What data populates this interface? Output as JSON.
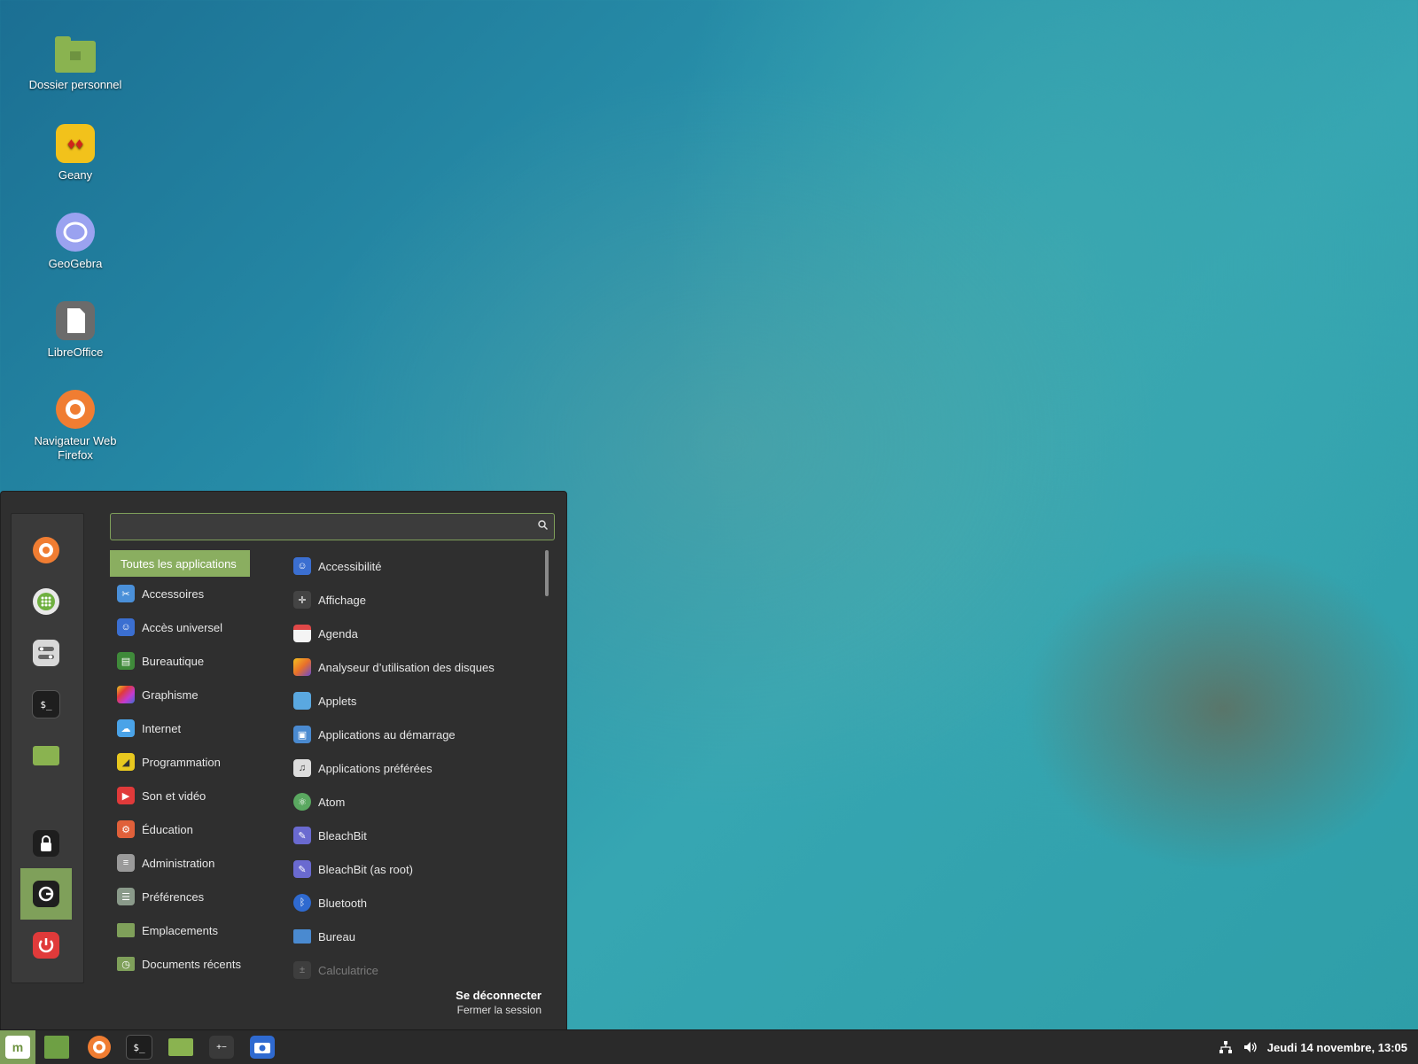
{
  "desktop": {
    "icons": [
      {
        "label": "Dossier personnel",
        "icon": "home-folder-icon"
      },
      {
        "label": "Geany",
        "icon": "geany-icon"
      },
      {
        "label": "GeoGebra",
        "icon": "geogebra-icon"
      },
      {
        "label": "LibreOffice",
        "icon": "libreoffice-icon"
      },
      {
        "label": "Navigateur Web Firefox",
        "icon": "firefox-icon"
      }
    ]
  },
  "menu": {
    "search": {
      "value": "",
      "placeholder": ""
    },
    "favorites": [
      {
        "icon": "firefox-icon"
      },
      {
        "icon": "software-manager-icon"
      },
      {
        "icon": "settings-icon"
      },
      {
        "icon": "terminal-icon"
      },
      {
        "icon": "folder-icon"
      },
      {
        "icon": "lock-icon"
      },
      {
        "icon": "logout-icon"
      },
      {
        "icon": "power-icon"
      }
    ],
    "categories": [
      {
        "label": "Toutes les applications",
        "icon": ""
      },
      {
        "label": "Accessoires",
        "icon": "accessories-icon",
        "color": "#4a90d9"
      },
      {
        "label": "Accès universel",
        "icon": "accessibility-icon",
        "color": "#3b6fd1"
      },
      {
        "label": "Bureautique",
        "icon": "office-icon",
        "color": "#3f8a3a"
      },
      {
        "label": "Graphisme",
        "icon": "graphics-icon",
        "color": "#c23ad1"
      },
      {
        "label": "Internet",
        "icon": "internet-icon",
        "color": "#4aa3e8"
      },
      {
        "label": "Programmation",
        "icon": "programming-icon",
        "color": "#e8c81f"
      },
      {
        "label": "Son et vidéo",
        "icon": "multimedia-icon",
        "color": "#e03a3a"
      },
      {
        "label": "Éducation",
        "icon": "education-icon",
        "color": "#e0603a"
      },
      {
        "label": "Administration",
        "icon": "administration-icon",
        "color": "#9a9a9a"
      },
      {
        "label": "Préférences",
        "icon": "preferences-icon",
        "color": "#8a9a8a"
      },
      {
        "label": "Emplacements",
        "icon": "places-icon",
        "color": "#7fa05a"
      },
      {
        "label": "Documents récents",
        "icon": "recent-documents-icon",
        "color": "#7fa05a"
      }
    ],
    "apps": [
      {
        "label": "Accessibilité",
        "icon": "accessibility-icon",
        "color": "#3b6fd1"
      },
      {
        "label": "Affichage",
        "icon": "display-icon",
        "color": "#444444"
      },
      {
        "label": "Agenda",
        "icon": "calendar-icon",
        "color": "#e04848"
      },
      {
        "label": "Analyseur d’utilisation des disques",
        "icon": "disk-usage-icon",
        "color": "#e8902a"
      },
      {
        "label": "Applets",
        "icon": "applets-icon",
        "color": "#5aa8e0"
      },
      {
        "label": "Applications au démarrage",
        "icon": "startup-apps-icon",
        "color": "#4a8ad0"
      },
      {
        "label": "Applications préférées",
        "icon": "preferred-apps-icon",
        "color": "#dddddd"
      },
      {
        "label": "Atom",
        "icon": "atom-icon",
        "color": "#5aa860"
      },
      {
        "label": "BleachBit",
        "icon": "bleachbit-icon",
        "color": "#6a6ad0"
      },
      {
        "label": "BleachBit (as root)",
        "icon": "bleachbit-root-icon",
        "color": "#6a6ad0"
      },
      {
        "label": "Bluetooth",
        "icon": "bluetooth-icon",
        "color": "#2f6ad0"
      },
      {
        "label": "Bureau",
        "icon": "desktop-icon",
        "color": "#4a8ad0"
      },
      {
        "label": "Calculatrice",
        "icon": "calculator-icon",
        "color": "#555555",
        "dim": true
      }
    ],
    "session": {
      "action": "Se déconnecter",
      "description": "Fermer la session"
    }
  },
  "taskbar": {
    "items": [
      {
        "icon": "show-desktop-icon"
      },
      {
        "icon": "firefox-icon"
      },
      {
        "icon": "terminal-icon"
      },
      {
        "icon": "file-manager-icon"
      },
      {
        "icon": "calculator-icon"
      },
      {
        "icon": "screenshot-icon"
      }
    ],
    "clock": "Jeudi 14 novembre, 13:05"
  }
}
